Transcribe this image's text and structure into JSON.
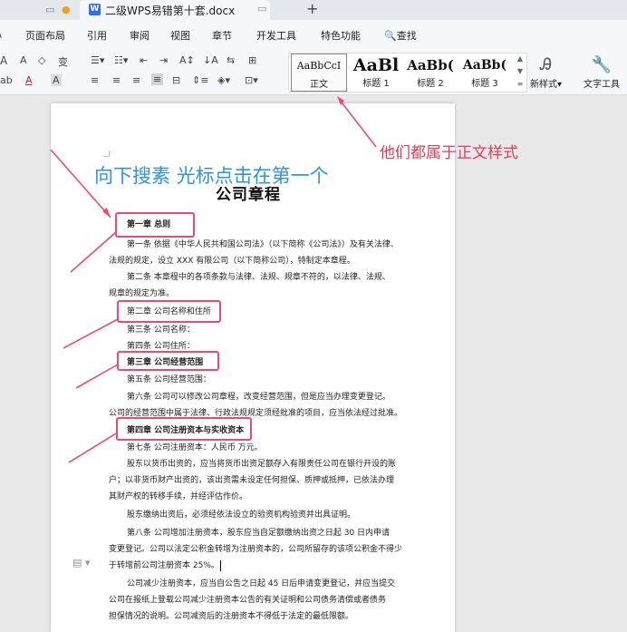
{
  "window": {
    "tab_title": "二级WPS易错第十套.docx",
    "tab_badge": "W",
    "plus_label": "+"
  },
  "menu": {
    "items": [
      "页面布局",
      "引用",
      "审阅",
      "视图",
      "章节",
      "开发工具",
      "特色功能"
    ],
    "search_label": "查找"
  },
  "ribbon": {
    "format_row1": [
      "A",
      "A",
      "◇",
      "变"
    ],
    "format_row2": [
      "ab",
      "A",
      "A"
    ],
    "styles": [
      {
        "preview": "AaBbCcI",
        "name": "正文"
      },
      {
        "preview": "AaBl",
        "name": "标题 1"
      },
      {
        "preview": "AaBb(",
        "name": "标题 2"
      },
      {
        "preview": "AaBb(",
        "name": "标题 3"
      }
    ],
    "new_style_label": "新样式",
    "text_tools_label": "文字工具"
  },
  "document": {
    "title": "公司章程",
    "lines": [
      "第一章  总则",
      "第一条  依据《中华人民共和国公司法》（以下简称《公司法》）及有关法律、",
      "法规的规定，设立 XXX 有限公司（以下简称公司），特制定本章程。",
      "第二条  本章程中的各项条款与法律、法规、规章不符的，以法律、法规、",
      "规章的规定为准。",
      "第二章  公司名称和住所",
      "第三条  公司名称：",
      "第四条  公司住所：",
      "第三章  公司经营范围",
      "第五条  公司经营范围：",
      "第六条  公司可以修改公司章程，改变经营范围，但是应当办理变更登记。",
      "公司的经营范围中属于法律、行政法规规定须经批准的项目，应当依法经过批准。",
      "第四章  公司注册资本与实收资本",
      "第七条  公司注册资本：人民币                    万元。",
      "股东以货币出资的，应当将货币出资足额存入有限责任公司在银行开设的账",
      "户；以非货币财产出资的，该出资需未设定任何担保、质押或抵押，已依法办理",
      "其财产权的转移手续，并经评估作价。",
      "股东缴纳出资后，必须经依法设立的验资机构验资并出具证明。",
      "第八条  公司增加注册资本，股东应当自足额缴纳出资之日起 30 日内申请",
      "变更登记。公司以法定公积金转增为注册资本的，公司所留存的该项公积金不得少",
      "于转增前公司注册资本 25%。",
      "公司减少注册资本，应当自公告之日起 45 日后申请变更登记，并应当提交",
      "公司在报纸上登载公司减少注册资本公告的有关证明和公司债务清偿或者债务",
      "担保情况的说明。公司减资后的注册资本不得低于法定的最低限额。"
    ]
  },
  "annotations": {
    "blue_text": "向下搜素 光标点击在第一个",
    "red_text": "他们都属于正文样式",
    "accent_red": "#ec4a6f",
    "accent_blue": "#2d93e6"
  }
}
